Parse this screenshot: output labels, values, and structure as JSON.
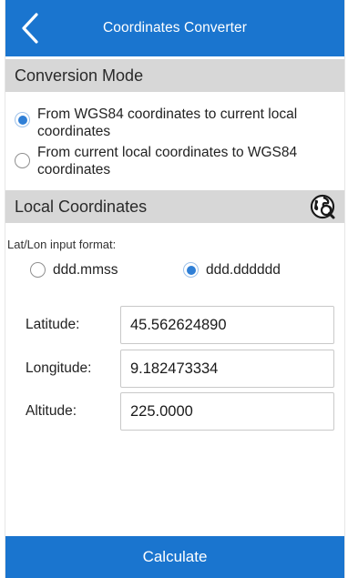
{
  "theme": {
    "accent": "#1a75cf"
  },
  "header": {
    "title": "Coordinates Converter",
    "back_icon": "chevron-left-icon"
  },
  "conversion_mode": {
    "title": "Conversion Mode",
    "options": [
      {
        "line1": "From WGS84 coordinates to current local",
        "line2": "coordinates",
        "selected": true
      },
      {
        "line1": "From current local coordinates to WGS84",
        "line2": "coordinates",
        "selected": false
      }
    ]
  },
  "local_coordinates": {
    "title": "Local Coordinates",
    "action_icon": "globe-search-icon",
    "format_label": "Lat/Lon input format:",
    "formats": [
      {
        "label": "ddd.mmss",
        "selected": false
      },
      {
        "label": "ddd.dddddd",
        "selected": true
      }
    ],
    "fields": [
      {
        "label": "Latitude:",
        "value": "45.562624890"
      },
      {
        "label": "Longitude:",
        "value": "9.182473334"
      },
      {
        "label": "Altitude:",
        "value": "225.0000"
      }
    ]
  },
  "footer": {
    "button_label": "Calculate"
  }
}
